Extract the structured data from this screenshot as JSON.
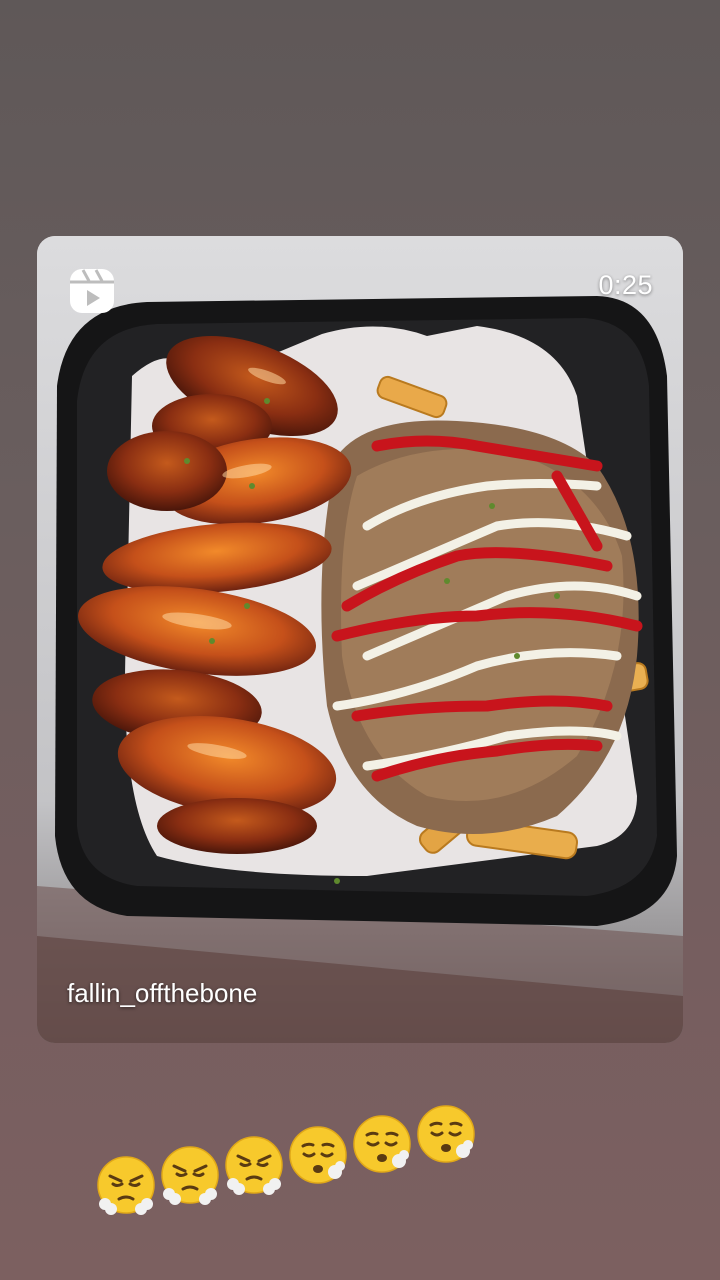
{
  "story": {
    "reel_card": {
      "icon": "reels-icon",
      "duration": "0:25",
      "username": "fallin_offthebone",
      "media": "food-photo-wings-and-loaded-fries"
    },
    "sticker_emojis": [
      {
        "icon": "face-with-steam-from-nose",
        "label": "😤"
      },
      {
        "icon": "face-with-steam-from-nose",
        "label": "😤"
      },
      {
        "icon": "face-with-steam-from-nose",
        "label": "😤"
      },
      {
        "icon": "sleepy-face",
        "label": "😪"
      },
      {
        "icon": "sleepy-face",
        "label": "😪"
      },
      {
        "icon": "sleepy-face",
        "label": "😪"
      }
    ]
  },
  "colors": {
    "background_top": "#5f5858",
    "background_bottom": "#7c6060",
    "emoji_yellow": "#f7c92c"
  }
}
